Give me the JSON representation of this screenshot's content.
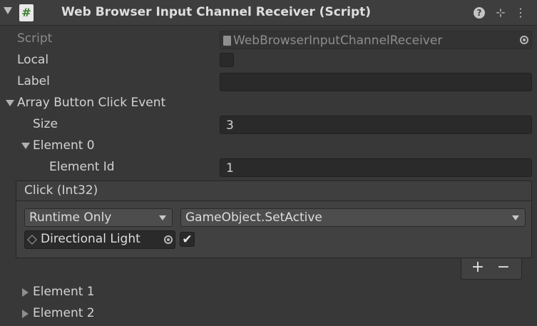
{
  "header": {
    "script_icon": "#",
    "title": "Web Browser Input Channel Receiver (Script)",
    "help_icon": "?",
    "settings_icon": "⊹",
    "more_icon": "⋮"
  },
  "props": {
    "script_label": "Script",
    "script_value": "WebBrowserInputChannelReceiver",
    "local_label": "Local",
    "local_checked": false,
    "label_label": "Label",
    "label_value": "",
    "array_label": "Array Button Click Event",
    "size_label": "Size",
    "size_value": "3",
    "element0_label": "Element 0",
    "element_id_label": "Element Id",
    "element_id_value": "1"
  },
  "event": {
    "title": "Click (Int32)",
    "mode": "Runtime Only",
    "function": "GameObject.SetActive",
    "target": "Directional Light",
    "arg_checked": true,
    "add_label": "+",
    "remove_label": "−"
  },
  "elements_collapsed": [
    "Element 1",
    "Element 2"
  ]
}
